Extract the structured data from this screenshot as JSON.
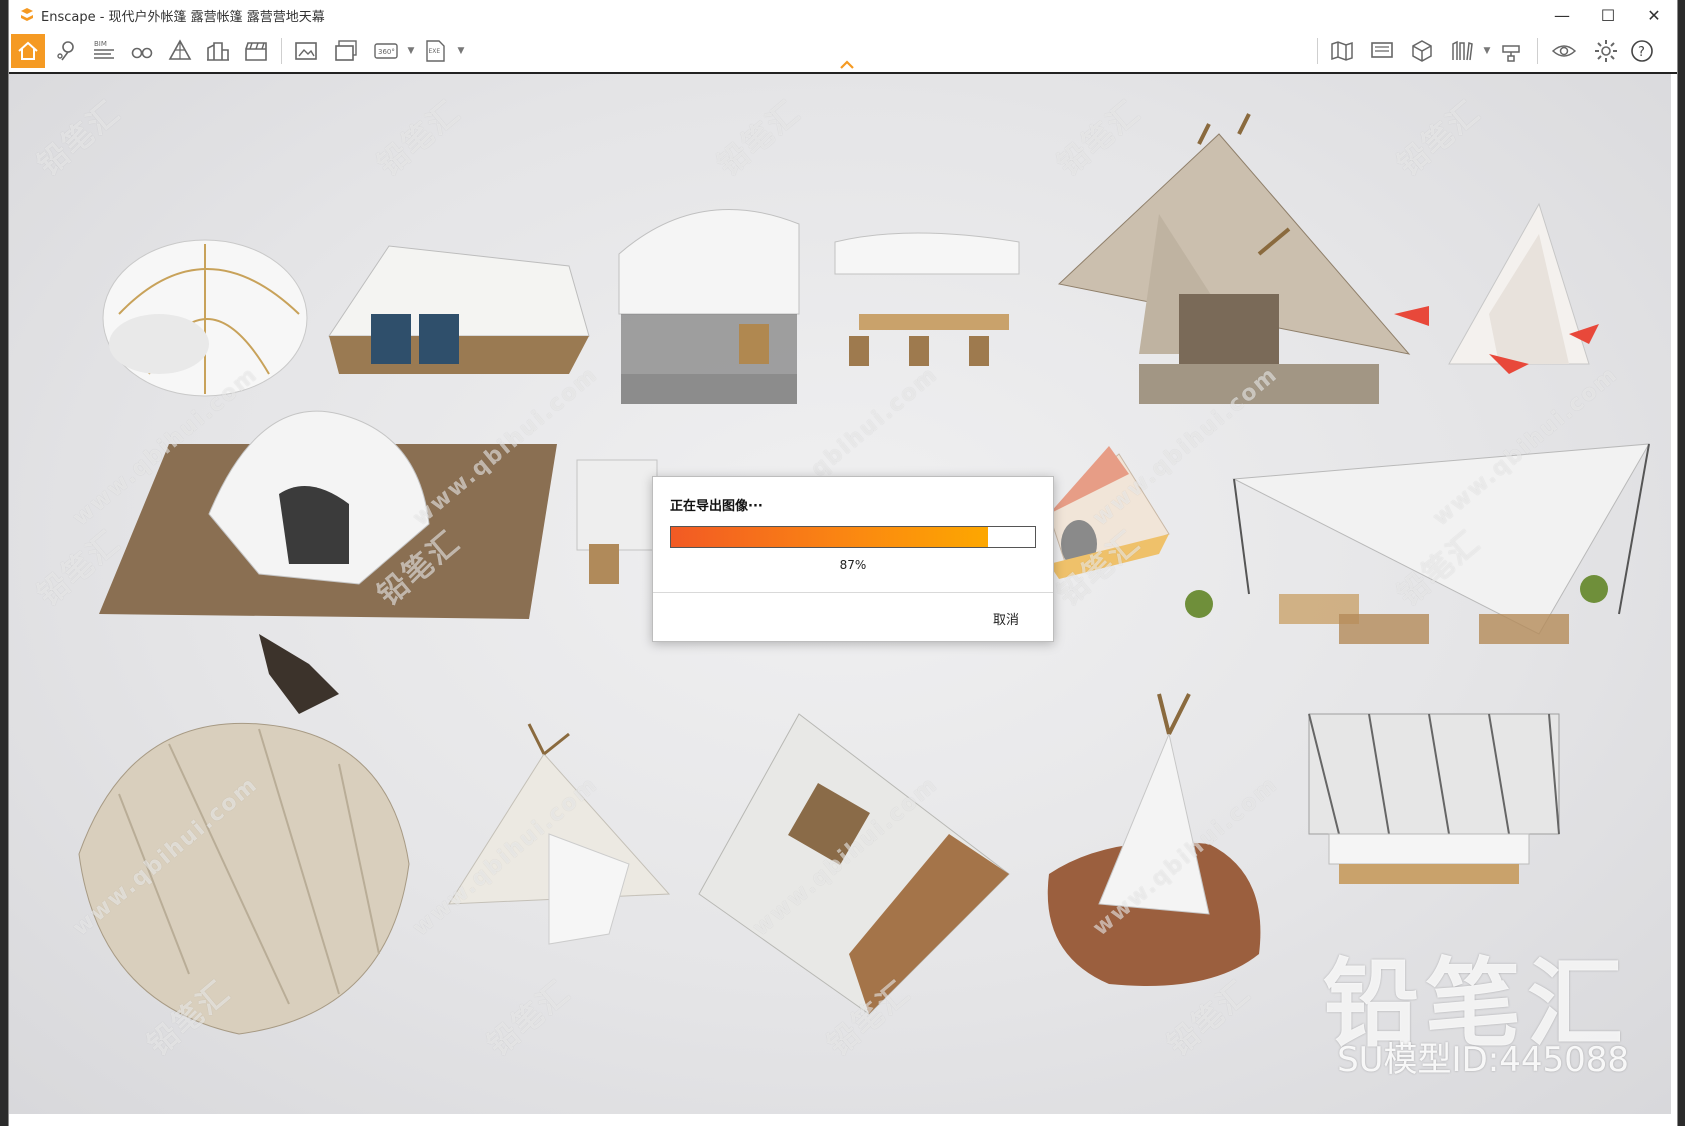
{
  "window": {
    "app_name": "Enscape",
    "title": "Enscape - 现代户外帐篷 露营帐篷 露营营地天幕",
    "controls": {
      "minimize": "—",
      "maximize": "☐",
      "close": "✕"
    }
  },
  "toolbar": {
    "left": [
      {
        "name": "home-icon",
        "label": "Home"
      },
      {
        "name": "location-pin-icon",
        "label": "Views"
      },
      {
        "name": "bim-icon",
        "label": "BIM"
      },
      {
        "name": "binoculars-icon",
        "label": "Walk mode"
      },
      {
        "name": "triangle-icon",
        "label": "Mode"
      },
      {
        "name": "buildings-icon",
        "label": "Assets"
      },
      {
        "name": "clapper-icon",
        "label": "Video"
      },
      {
        "name": "screenshot-icon",
        "label": "Screenshot"
      },
      {
        "name": "batch-render-icon",
        "label": "Batch"
      },
      {
        "name": "panorama-360-icon",
        "label": "360°"
      },
      {
        "name": "exe-export-icon",
        "label": "EXE"
      }
    ],
    "bim_text": "BIM",
    "pano_text": "360°",
    "exe_text": "EXE",
    "right": [
      {
        "name": "map-icon"
      },
      {
        "name": "monitor-icon"
      },
      {
        "name": "cube-icon"
      },
      {
        "name": "library-icon"
      },
      {
        "name": "material-icon"
      },
      {
        "name": "eye-icon"
      },
      {
        "name": "gear-icon"
      },
      {
        "name": "help-icon"
      }
    ]
  },
  "dialog": {
    "title": "正在导出图像···",
    "progress": 0.87,
    "progress_text": "87%",
    "cancel_label": "取消"
  },
  "watermark": {
    "text": "铅笔汇",
    "url_text": "www.qbihui.com",
    "brand": "铅笔汇",
    "model_id": "SU模型ID:445088"
  },
  "colors": {
    "accent": "#f59a23",
    "progress_start": "#f25a24",
    "progress_end": "#fda700"
  }
}
